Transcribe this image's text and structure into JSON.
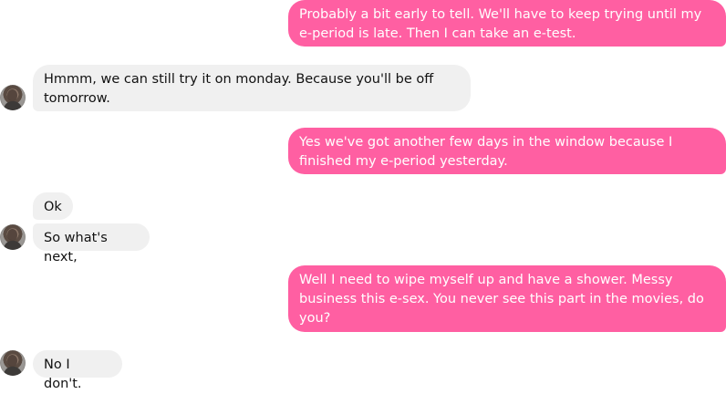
{
  "chat": {
    "messages": [
      {
        "id": "m1",
        "sender": "me",
        "text": "Probably a bit early to tell. We'll have to keep trying until my e-period is late. Then I can take an e-test."
      },
      {
        "id": "m2",
        "sender": "them",
        "text": "Hmmm, we can still try it on monday. Because you'll be off tomorrow."
      },
      {
        "id": "m3",
        "sender": "me",
        "text": "Yes we've got another few days in the window because I finished my e-period yesterday."
      },
      {
        "id": "m4",
        "sender": "them",
        "text": "Ok"
      },
      {
        "id": "m5",
        "sender": "them",
        "text": "So what's next,"
      },
      {
        "id": "m6",
        "sender": "me",
        "text": "Well I need to wipe myself up and have a shower. Messy business this e-sex. You never see this part in the movies, do you?"
      },
      {
        "id": "m7",
        "sender": "them",
        "text": "No I don't."
      }
    ]
  },
  "theme": {
    "outgoing_bubble_color": "#ff5fa2",
    "incoming_bubble_color": "#f0f0f0",
    "outgoing_text_color": "#ffffff",
    "incoming_text_color": "#111111"
  },
  "icons": {
    "avatar": "contact-avatar-icon"
  }
}
